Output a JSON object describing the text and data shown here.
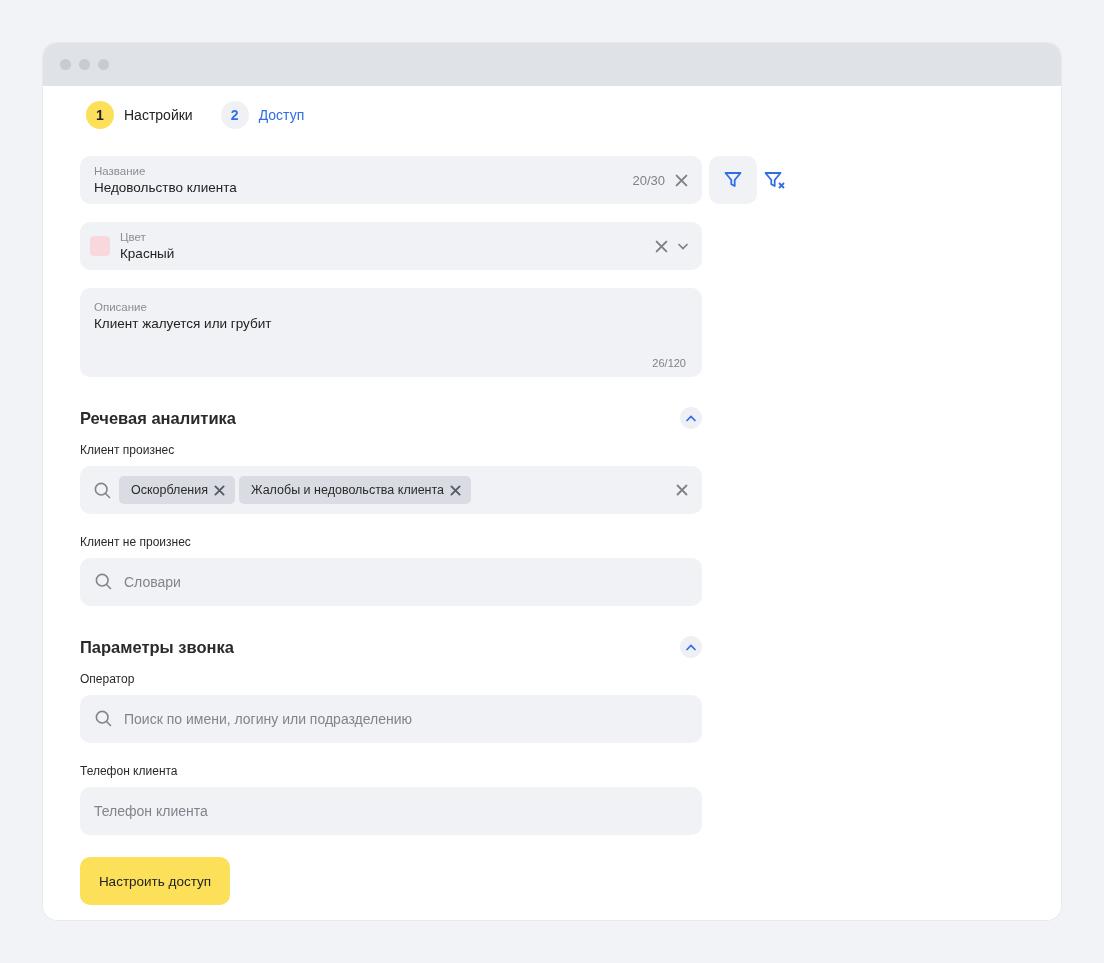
{
  "steps": [
    {
      "number": "1",
      "label": "Настройки",
      "selected": true
    },
    {
      "number": "2",
      "label": "Доступ",
      "selected": false
    }
  ],
  "name_field": {
    "label": "Название",
    "value": "Недовольство клиента",
    "counter": "20/30"
  },
  "color_field": {
    "label": "Цвет",
    "value": "Красный",
    "color": "#f8d8dc"
  },
  "description_field": {
    "label": "Описание",
    "value": "Клиент жалуется или грубит",
    "counter": "26/120"
  },
  "sections": [
    {
      "title": "Речевая аналитика",
      "expanded": true,
      "fields": [
        {
          "kind": "tags",
          "label": "Клиент произнес",
          "tags": [
            "Оскорбления",
            "Жалобы и недовольства клиента"
          ]
        },
        {
          "kind": "search",
          "label": "Клиент не произнес",
          "placeholder": "Словари"
        }
      ]
    },
    {
      "title": "Параметры звонка",
      "expanded": true,
      "fields": [
        {
          "kind": "search",
          "label": "Оператор",
          "placeholder": "Поиск по имени, логину или подразделению"
        },
        {
          "kind": "plain",
          "label": "Телефон клиента",
          "placeholder": "Телефон клиента"
        }
      ]
    }
  ],
  "submit_button": "Настроить доступ"
}
